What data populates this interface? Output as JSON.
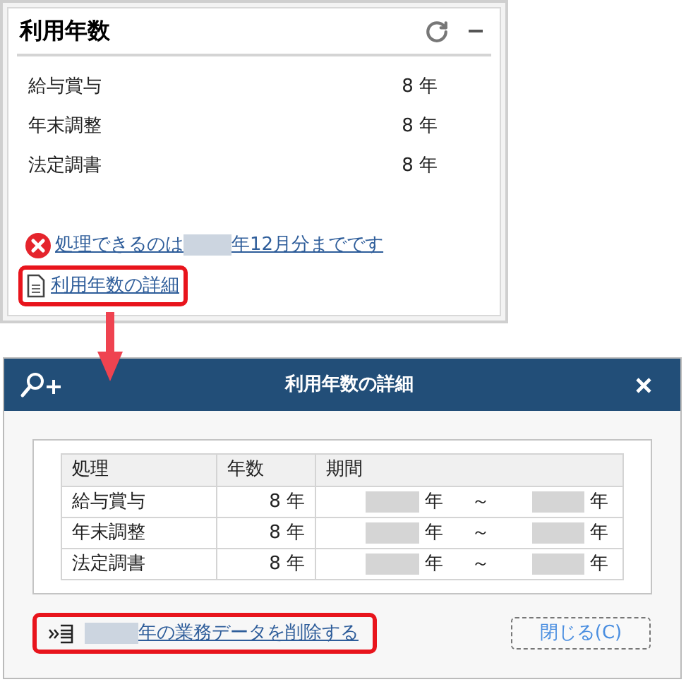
{
  "panel": {
    "title": "利用年数",
    "rows": [
      {
        "label": "給与賞与",
        "value": "8 年"
      },
      {
        "label": "年末調整",
        "value": "8 年"
      },
      {
        "label": "法定調書",
        "value": "8 年"
      }
    ],
    "notice": {
      "before": "処理できるのは",
      "after": "年12月分までです"
    },
    "detail_link": "利用年数の詳細"
  },
  "dialog": {
    "title": "利用年数の詳細",
    "table": {
      "columns": [
        "処理",
        "年数",
        "期間"
      ],
      "rows": [
        {
          "process": "給与賞与",
          "years": "8 年",
          "period": {
            "start_unit": "年",
            "separator": "～",
            "end_unit": "年"
          }
        },
        {
          "process": "年末調整",
          "years": "8 年",
          "period": {
            "start_unit": "年",
            "separator": "～",
            "end_unit": "年"
          }
        },
        {
          "process": "法定調書",
          "years": "8 年",
          "period": {
            "start_unit": "年",
            "separator": "～",
            "end_unit": "年"
          }
        }
      ]
    },
    "delete_link": "年の業務データを削除する",
    "close_button": "閉じる(C)"
  }
}
